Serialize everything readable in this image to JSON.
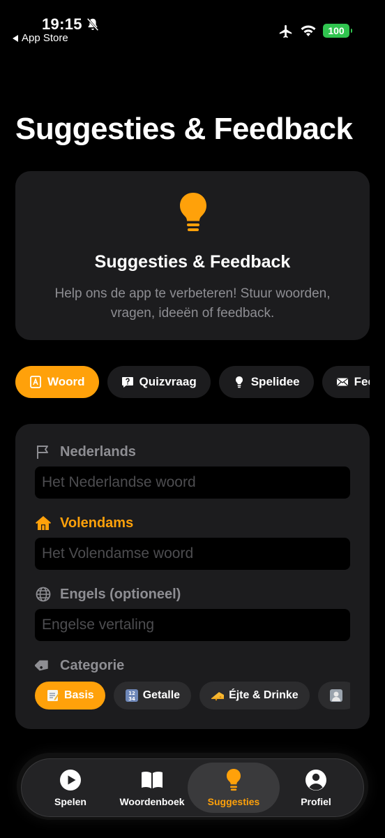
{
  "status_bar": {
    "time": "19:15",
    "back_app": "App Store",
    "battery": "100"
  },
  "page": {
    "title": "Suggesties & Feedback"
  },
  "hero": {
    "icon": "lightbulb-icon",
    "title": "Suggesties & Feedback",
    "description": "Help ons de app te verbeteren! Stuur woorden, vragen, ideeën of feedback."
  },
  "tabs": [
    {
      "label": "Woord",
      "icon": "book-icon",
      "active": true
    },
    {
      "label": "Quizvraag",
      "icon": "question-bubble-icon",
      "active": false
    },
    {
      "label": "Spelidee",
      "icon": "lightbulb-icon",
      "active": false
    },
    {
      "label": "Feedback",
      "icon": "envelope-icon",
      "active": false
    }
  ],
  "form": {
    "dutch": {
      "label": "Nederlands",
      "placeholder": "Het Nederlandse woord"
    },
    "volendams": {
      "label": "Volendams",
      "placeholder": "Het Volendamse woord"
    },
    "english": {
      "label": "Engels (optioneel)",
      "placeholder": "Engelse vertaling"
    },
    "category": {
      "label": "Categorie",
      "options": [
        {
          "label": "Basis",
          "icon": "memo-emoji",
          "active": true
        },
        {
          "label": "Getalle",
          "icon": "numbers-emoji",
          "active": false
        },
        {
          "label": "Éjte & Drinke",
          "icon": "cheese-emoji",
          "active": false
        },
        {
          "label": "",
          "icon": "people-emoji",
          "active": false
        }
      ]
    }
  },
  "tabbar": {
    "items": [
      {
        "label": "Spelen",
        "icon": "play-icon"
      },
      {
        "label": "Woordenboek",
        "icon": "open-book-icon"
      },
      {
        "label": "Suggesties",
        "icon": "lightbulb-icon",
        "active": true
      },
      {
        "label": "Profiel",
        "icon": "person-icon"
      }
    ]
  },
  "colors": {
    "accent": "#ffa10a",
    "card": "#1c1c1e",
    "muted": "#8e8e93",
    "battery": "#30c44f"
  }
}
